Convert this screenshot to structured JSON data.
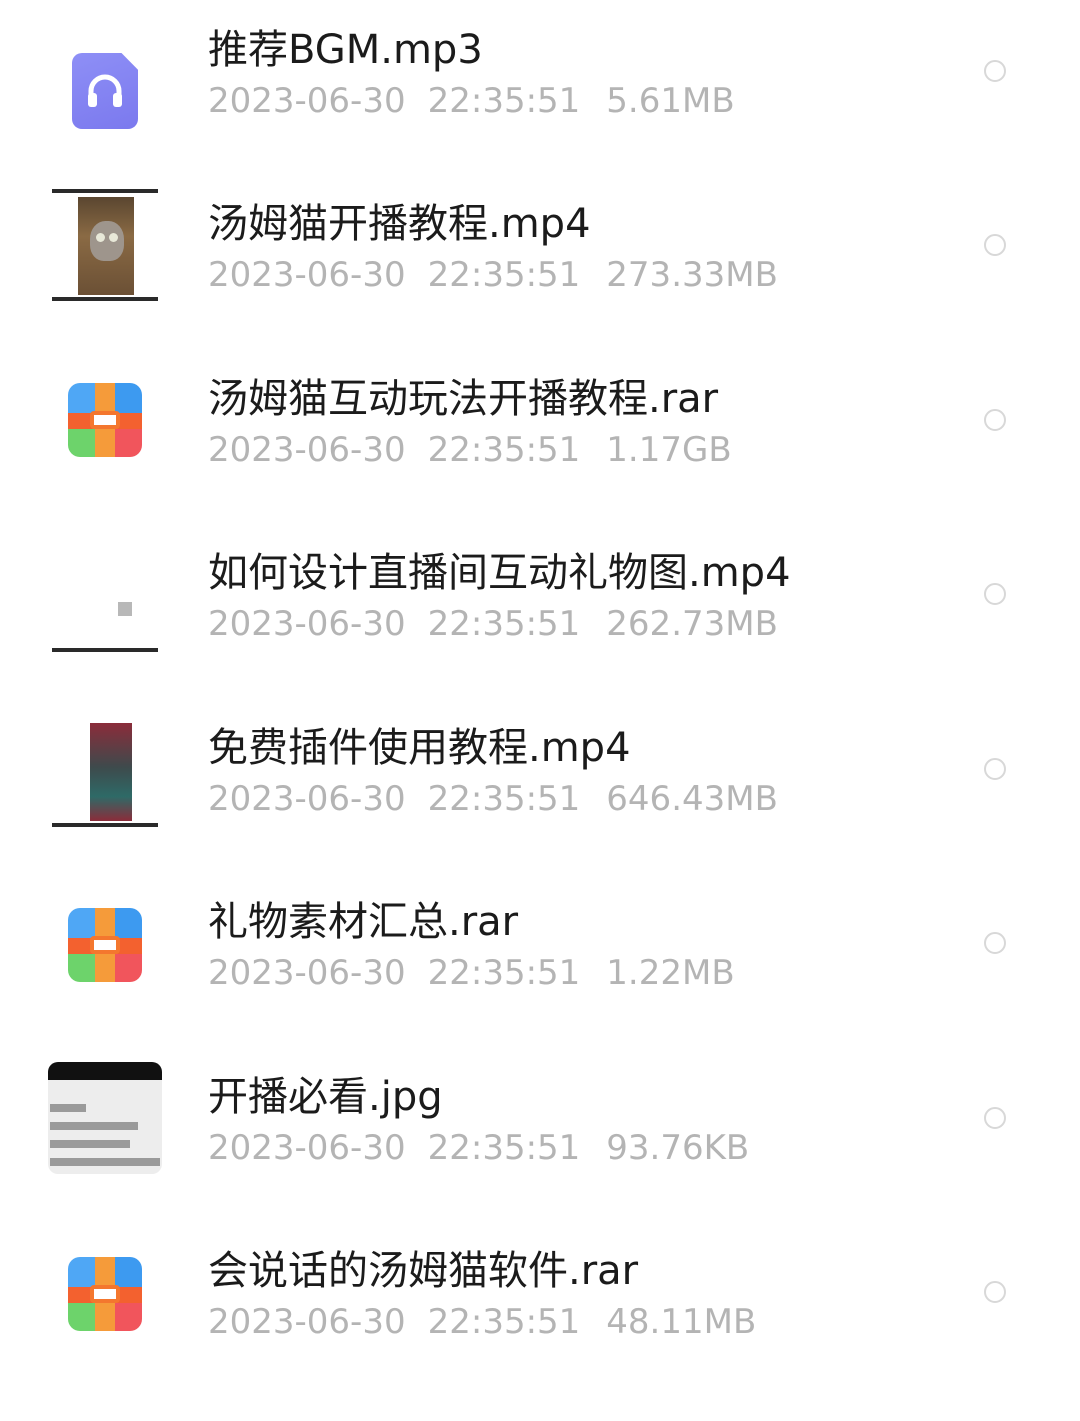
{
  "files": [
    {
      "name": "推荐BGM.mp3",
      "date": "2023-06-30",
      "time": "22:35:51",
      "size": "5.61MB",
      "icon": "audio-file-icon"
    },
    {
      "name": "汤姆猫开播教程.mp4",
      "date": "2023-06-30",
      "time": "22:35:51",
      "size": "273.33MB",
      "icon": "video-thumbnail"
    },
    {
      "name": "汤姆猫互动玩法开播教程.rar",
      "date": "2023-06-30",
      "time": "22:35:51",
      "size": "1.17GB",
      "icon": "archive-file-icon"
    },
    {
      "name": "如何设计直播间互动礼物图.mp4",
      "date": "2023-06-30",
      "time": "22:35:51",
      "size": "262.73MB",
      "icon": "video-thumbnail"
    },
    {
      "name": "免费插件使用教程.mp4",
      "date": "2023-06-30",
      "time": "22:35:51",
      "size": "646.43MB",
      "icon": "video-thumbnail"
    },
    {
      "name": "礼物素材汇总.rar",
      "date": "2023-06-30",
      "time": "22:35:51",
      "size": "1.22MB",
      "icon": "archive-file-icon"
    },
    {
      "name": "开播必看.jpg",
      "date": "2023-06-30",
      "time": "22:35:51",
      "size": "93.76KB",
      "icon": "image-thumbnail"
    },
    {
      "name": "会说话的汤姆猫软件.rar",
      "date": "2023-06-30",
      "time": "22:35:51",
      "size": "48.11MB",
      "icon": "archive-file-icon"
    }
  ],
  "colors": {
    "name_text": "#1b1b1b",
    "meta_text": "#b4b4b4",
    "audio_icon": "#8a89f3",
    "radio_border": "#d8d8d8"
  }
}
